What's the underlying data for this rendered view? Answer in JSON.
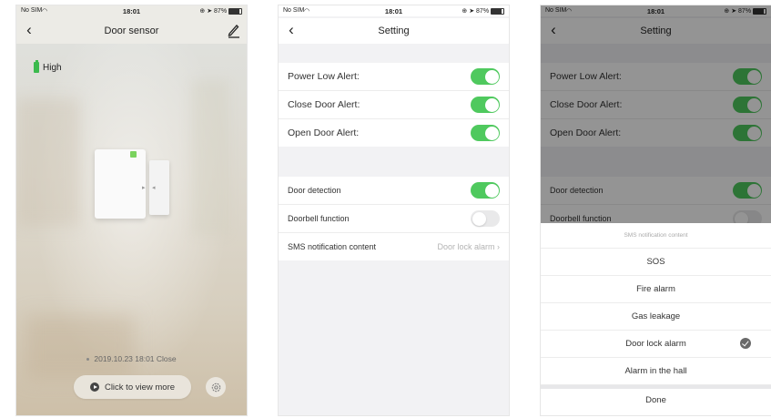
{
  "status_bar": {
    "carrier": "No SIM",
    "time": "18:01",
    "battery": "87%"
  },
  "screen1": {
    "title": "Door sensor",
    "battery_label": "High",
    "event": "2019.10.23 18:01 Close",
    "view_more": "Click to view more",
    "icons": {
      "back": "back-chevron-icon",
      "edit": "edit-pencil-icon",
      "settings": "settings-gear-icon",
      "play": "play-icon"
    },
    "colors": {
      "battery": "#3cba4e",
      "led": "#7ad35e"
    }
  },
  "screen2": {
    "title": "Setting",
    "alerts": [
      {
        "label": "Power Low Alert:",
        "on": true
      },
      {
        "label": "Close Door Alert:",
        "on": true
      },
      {
        "label": "Open Door Alert:",
        "on": true
      }
    ],
    "functions": [
      {
        "label": "Door detection",
        "on": true
      },
      {
        "label": "Doorbell function",
        "on": false
      }
    ],
    "sms": {
      "label": "SMS notification content",
      "value": "Door lock alarm"
    },
    "colors": {
      "toggle_on": "#4fc95e",
      "toggle_off": "#e9e9ea"
    }
  },
  "screen3": {
    "title": "Setting",
    "sheet_title": "SMS notification content",
    "options": [
      "SOS",
      "Fire alarm",
      "Gas leakage",
      "Door lock alarm",
      "Alarm  in the hall"
    ],
    "selected": "Door lock alarm",
    "done": "Done"
  }
}
